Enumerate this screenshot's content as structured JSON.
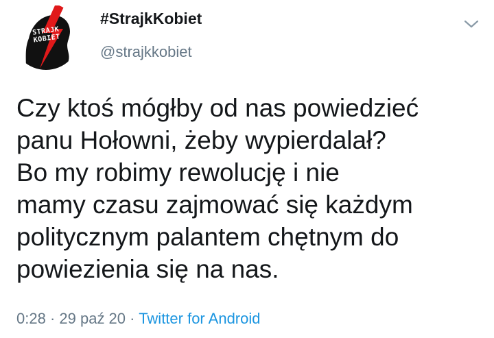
{
  "author": {
    "display_name": "#StrajkKobiet",
    "handle": "@strajkkobiet",
    "avatar_text_line1": "STRAJK",
    "avatar_text_line2": "KOBIET"
  },
  "tweet": {
    "lines": [
      "Czy ktoś mógłby od nas powiedzieć",
      "panu Hołowni, żeby wypierdalał?",
      "Bo my robimy rewolucję i nie",
      "mamy czasu zajmować się każdym",
      "politycznym palantem chętnym do",
      "powiezienia się na nas."
    ],
    "time": "0:28",
    "separator1": " · ",
    "date": "29 paź 20",
    "separator2": " · ",
    "source": "Twitter for Android"
  },
  "icons": {
    "menu": "chevron-down-icon",
    "avatar": "bolt-logo-icon"
  },
  "colors": {
    "text": "#14171a",
    "muted": "#657786",
    "link": "#1b95e0",
    "bolt": "#e0191a"
  }
}
